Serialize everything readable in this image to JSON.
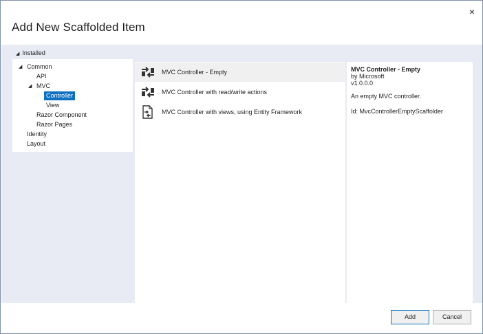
{
  "dialog": {
    "title": "Add New Scaffolded Item",
    "close_glyph": "×"
  },
  "sidebar": {
    "root_label": "Installed",
    "items": [
      {
        "label": "Common",
        "expanded": true
      },
      {
        "label": "API"
      },
      {
        "label": "MVC",
        "expanded": true
      },
      {
        "label": "Controller",
        "selected": true
      },
      {
        "label": "View"
      },
      {
        "label": "Razor Component"
      },
      {
        "label": "Razor Pages"
      },
      {
        "label": "Identity"
      },
      {
        "label": "Layout"
      }
    ]
  },
  "templates": [
    {
      "label": "MVC Controller - Empty",
      "icon": "controller-icon",
      "selected": true
    },
    {
      "label": "MVC Controller with read/write actions",
      "icon": "controller-icon"
    },
    {
      "label": "MVC Controller with views, using Entity Framework",
      "icon": "document-controller-icon"
    }
  ],
  "details": {
    "name": "MVC Controller - Empty",
    "author": "by Microsoft",
    "version": "v1.0.0.0",
    "description": "An empty MVC controller.",
    "id": "Id: MvcControllerEmptyScaffolder"
  },
  "buttons": {
    "add_label": "Add",
    "cancel_label": "Cancel"
  },
  "colors": {
    "selection": "#0e70c0",
    "panel_background": "#e8ebf3",
    "row_highlight": "#f0f0f0"
  }
}
